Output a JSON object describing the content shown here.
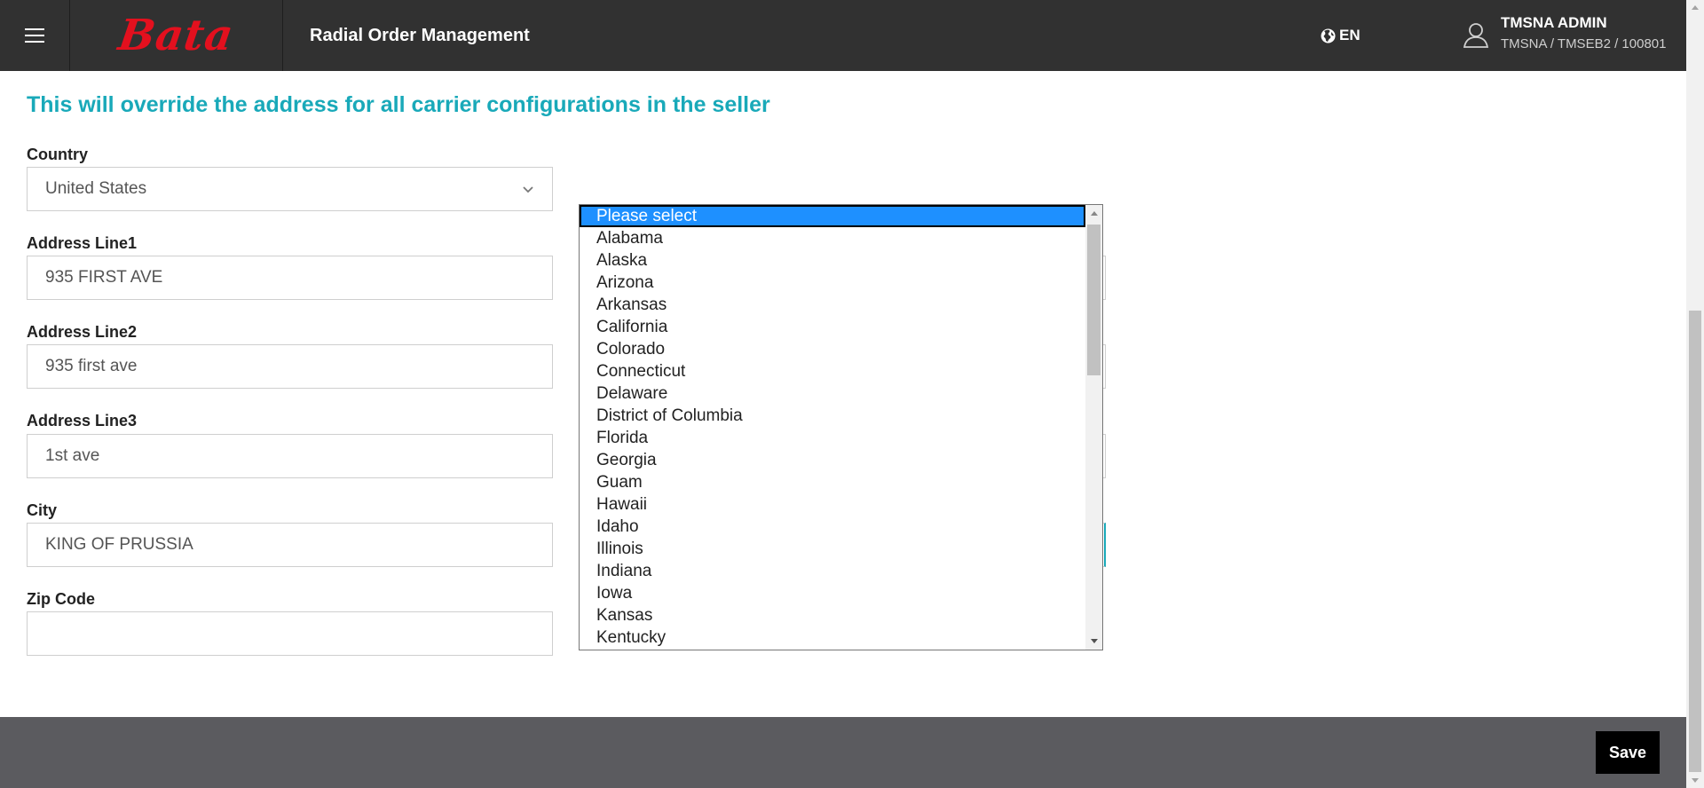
{
  "header": {
    "logo_text": "Bata",
    "app_title": "Radial Order Management",
    "language": "EN",
    "user_name": "TMSNA ADMIN",
    "user_path": "TMSNA / TMSEB2 / 100801"
  },
  "notice": "This will override the address for all carrier configurations in the seller",
  "form": {
    "country_label": "Country",
    "country_value": "United States",
    "address1_label": "Address Line1",
    "address1_value": "935 FIRST AVE",
    "address2_label": "Address Line2",
    "address2_value": "935 first ave",
    "address3_label": "Address Line3",
    "address3_value": "1st ave",
    "city_label": "City",
    "city_value": "KING OF PRUSSIA",
    "zip_label": "Zip Code",
    "zip_value": ""
  },
  "state_dropdown": {
    "selected": "Please select",
    "options": [
      "Please select",
      "Alabama",
      "Alaska",
      "Arizona",
      "Arkansas",
      "California",
      "Colorado",
      "Connecticut",
      "Delaware",
      "District of Columbia",
      "Florida",
      "Georgia",
      "Guam",
      "Hawaii",
      "Idaho",
      "Illinois",
      "Indiana",
      "Iowa",
      "Kansas",
      "Kentucky"
    ]
  },
  "footer": {
    "save_label": "Save"
  },
  "colors": {
    "header_bg": "#313131",
    "brand_red": "#e3101e",
    "accent_teal": "#19a9b9",
    "footer_bg": "#5b5b5f",
    "selected_option_bg": "#1e90ff"
  },
  "icons": {
    "menu": "hamburger-icon",
    "language": "globe-icon",
    "user": "user-icon",
    "country_select": "chevron-down-icon"
  }
}
